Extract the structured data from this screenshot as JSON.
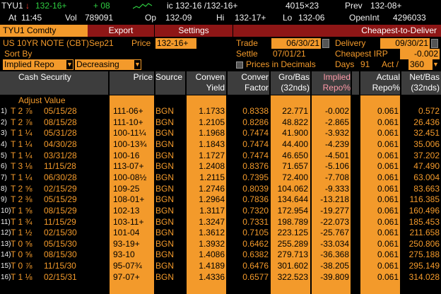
{
  "quote": {
    "ticker": "TYU1",
    "arrow": "↓",
    "last": "132-16+",
    "change": "+ 08",
    "bid_ask": "132-16 /132-16+",
    "size": "4015×23",
    "prev_label": "Prev",
    "prev": "132-08+",
    "at_label": "At",
    "time": "11:45",
    "vol_label": "Vol",
    "volume": "789091",
    "op_label": "Op",
    "open": "132-09",
    "hi_label": "Hi",
    "high": "132-17+",
    "lo_label": "Lo",
    "low": "132-06",
    "openint_label": "OpenInt",
    "open_interest": "4296033",
    "ic_label": "ic"
  },
  "header": {
    "security": "TYU1 Comdty",
    "export": "Export",
    "settings": "Settings",
    "title": "Cheapest-to-Deliver"
  },
  "params": {
    "contract": "US 10YR NOTE (CBT)Sep21",
    "price_label": "Price",
    "price": "132-16+",
    "trade_label": "Trade",
    "trade_date": "06/30/21",
    "delivery_label": "Delivery",
    "delivery_date": "09/30/21",
    "sortby_label": "Sort By",
    "settle_label": "Settle",
    "settle_date": "07/01/21",
    "cheapest_irp_label": "Cheapest IRP",
    "cheapest_irp": "-0.002",
    "sort_field": "Implied Repo",
    "sort_order": "Decreasing",
    "prices_decimals_label": "Prices in Decimals",
    "days_label": "Days",
    "days": "91",
    "act_label": "Act /",
    "act_basis": "360"
  },
  "table": {
    "headers": {
      "security": "Cash Security",
      "price": "Price",
      "source": "Source",
      "conv_yield_1": "Conven",
      "conv_yield_2": "Yield",
      "conv_factor_1": "Conver",
      "conv_factor_2": "Factor",
      "gross_basis_1": "Gro/Bas",
      "gross_basis_2": "(32nds)",
      "implied_repo_1": "Implied",
      "implied_repo_2": "Repo%",
      "actual_repo_1": "Actual",
      "actual_repo_2": "Repo%",
      "net_basis_1": "Net/Bas",
      "net_basis_2": "(32nds)"
    },
    "adjust_label": "Adjust Value",
    "rows": [
      {
        "n": "1)",
        "cpn": "T 2 ⅞",
        "mat": "05/15/28",
        "price": "111-06+",
        "src": "BGN",
        "yld": "1.1733",
        "cf": "0.8338",
        "gb": "22.771",
        "ir": "-0.002",
        "ar": "0.061",
        "nb": "0.572"
      },
      {
        "n": "2)",
        "cpn": "T 2 ⅞",
        "mat": "08/15/28",
        "price": "111-10+",
        "src": "BGN",
        "yld": "1.2105",
        "cf": "0.8286",
        "gb": "48.822",
        "ir": "-2.865",
        "ar": "0.061",
        "nb": "26.436"
      },
      {
        "n": "3)",
        "cpn": "T 1 ¼",
        "mat": "05/31/28",
        "price": "100-11¼",
        "src": "BGN",
        "yld": "1.1968",
        "cf": "0.7474",
        "gb": "41.900",
        "ir": "-3.932",
        "ar": "0.061",
        "nb": "32.451"
      },
      {
        "n": "4)",
        "cpn": "T 1 ¼",
        "mat": "04/30/28",
        "price": "100-13¾",
        "src": "BGN",
        "yld": "1.1843",
        "cf": "0.7474",
        "gb": "44.400",
        "ir": "-4.239",
        "ar": "0.061",
        "nb": "35.006"
      },
      {
        "n": "5)",
        "cpn": "T 1 ¼",
        "mat": "03/31/28",
        "price": "100-16",
        "src": "BGN",
        "yld": "1.1727",
        "cf": "0.7474",
        "gb": "46.650",
        "ir": "-4.501",
        "ar": "0.061",
        "nb": "37.202"
      },
      {
        "n": "6)",
        "cpn": "T 3 ⅛",
        "mat": "11/15/28",
        "price": "113-07+",
        "src": "BGN",
        "yld": "1.2408",
        "cf": "0.8376",
        "gb": "71.657",
        "ir": "-5.106",
        "ar": "0.061",
        "nb": "47.490"
      },
      {
        "n": "7)",
        "cpn": "T 1 ¼",
        "mat": "06/30/28",
        "price": "100-08½",
        "src": "BGN",
        "yld": "1.2115",
        "cf": "0.7395",
        "gb": "72.400",
        "ir": "-7.708",
        "ar": "0.061",
        "nb": "63.004"
      },
      {
        "n": "8)",
        "cpn": "T 2 ⅝",
        "mat": "02/15/29",
        "price": "109-25",
        "src": "BGN",
        "yld": "1.2746",
        "cf": "0.8039",
        "gb": "104.062",
        "ir": "-9.333",
        "ar": "0.061",
        "nb": "83.663"
      },
      {
        "n": "9)",
        "cpn": "T 2 ⅜",
        "mat": "05/15/29",
        "price": "108-01+",
        "src": "BGN",
        "yld": "1.2964",
        "cf": "0.7836",
        "gb": "134.644",
        "ir": "-13.218",
        "ar": "0.061",
        "nb": "116.385"
      },
      {
        "n": "10)",
        "cpn": "T 1 ⅝",
        "mat": "08/15/29",
        "price": "102-13",
        "src": "BGN",
        "yld": "1.3117",
        "cf": "0.7320",
        "gb": "172.954",
        "ir": "-19.277",
        "ar": "0.061",
        "nb": "160.496"
      },
      {
        "n": "11)",
        "cpn": "T 1 ¾",
        "mat": "11/15/29",
        "price": "103-11+",
        "src": "BGN",
        "yld": "1.3247",
        "cf": "0.7331",
        "gb": "198.789",
        "ir": "-22.073",
        "ar": "0.061",
        "nb": "185.453"
      },
      {
        "n": "12)",
        "cpn": "T 1 ½",
        "mat": "02/15/30",
        "price": "101-04",
        "src": "BGN",
        "yld": "1.3612",
        "cf": "0.7105",
        "gb": "223.125",
        "ir": "-25.767",
        "ar": "0.061",
        "nb": "211.658"
      },
      {
        "n": "13)",
        "cpn": "T 0 ⅝",
        "mat": "05/15/30",
        "price": "93-19+",
        "src": "BGN",
        "yld": "1.3932",
        "cf": "0.6462",
        "gb": "255.289",
        "ir": "-33.034",
        "ar": "0.061",
        "nb": "250.806"
      },
      {
        "n": "14)",
        "cpn": "T 0 ⅝",
        "mat": "08/15/30",
        "price": "93-10",
        "src": "BGN",
        "yld": "1.4086",
        "cf": "0.6382",
        "gb": "279.713",
        "ir": "-36.368",
        "ar": "0.061",
        "nb": "275.188"
      },
      {
        "n": "15)",
        "cpn": "T 0 ⅞",
        "mat": "11/15/30",
        "price": "95-07¾",
        "src": "BGN",
        "yld": "1.4189",
        "cf": "0.6476",
        "gb": "301.602",
        "ir": "-38.205",
        "ar": "0.061",
        "nb": "295.149"
      },
      {
        "n": "16)",
        "cpn": "T 1 ⅛",
        "mat": "02/15/31",
        "price": "97-07+",
        "src": "BGN",
        "yld": "1.4336",
        "cf": "0.6577",
        "gb": "322.523",
        "ir": "-39.809",
        "ar": "0.061",
        "nb": "314.028"
      }
    ]
  },
  "colors": {
    "accent": "#f39a2b",
    "header_red": "#8e1616",
    "up": "#2ecc40",
    "down": "#ff3b30"
  }
}
